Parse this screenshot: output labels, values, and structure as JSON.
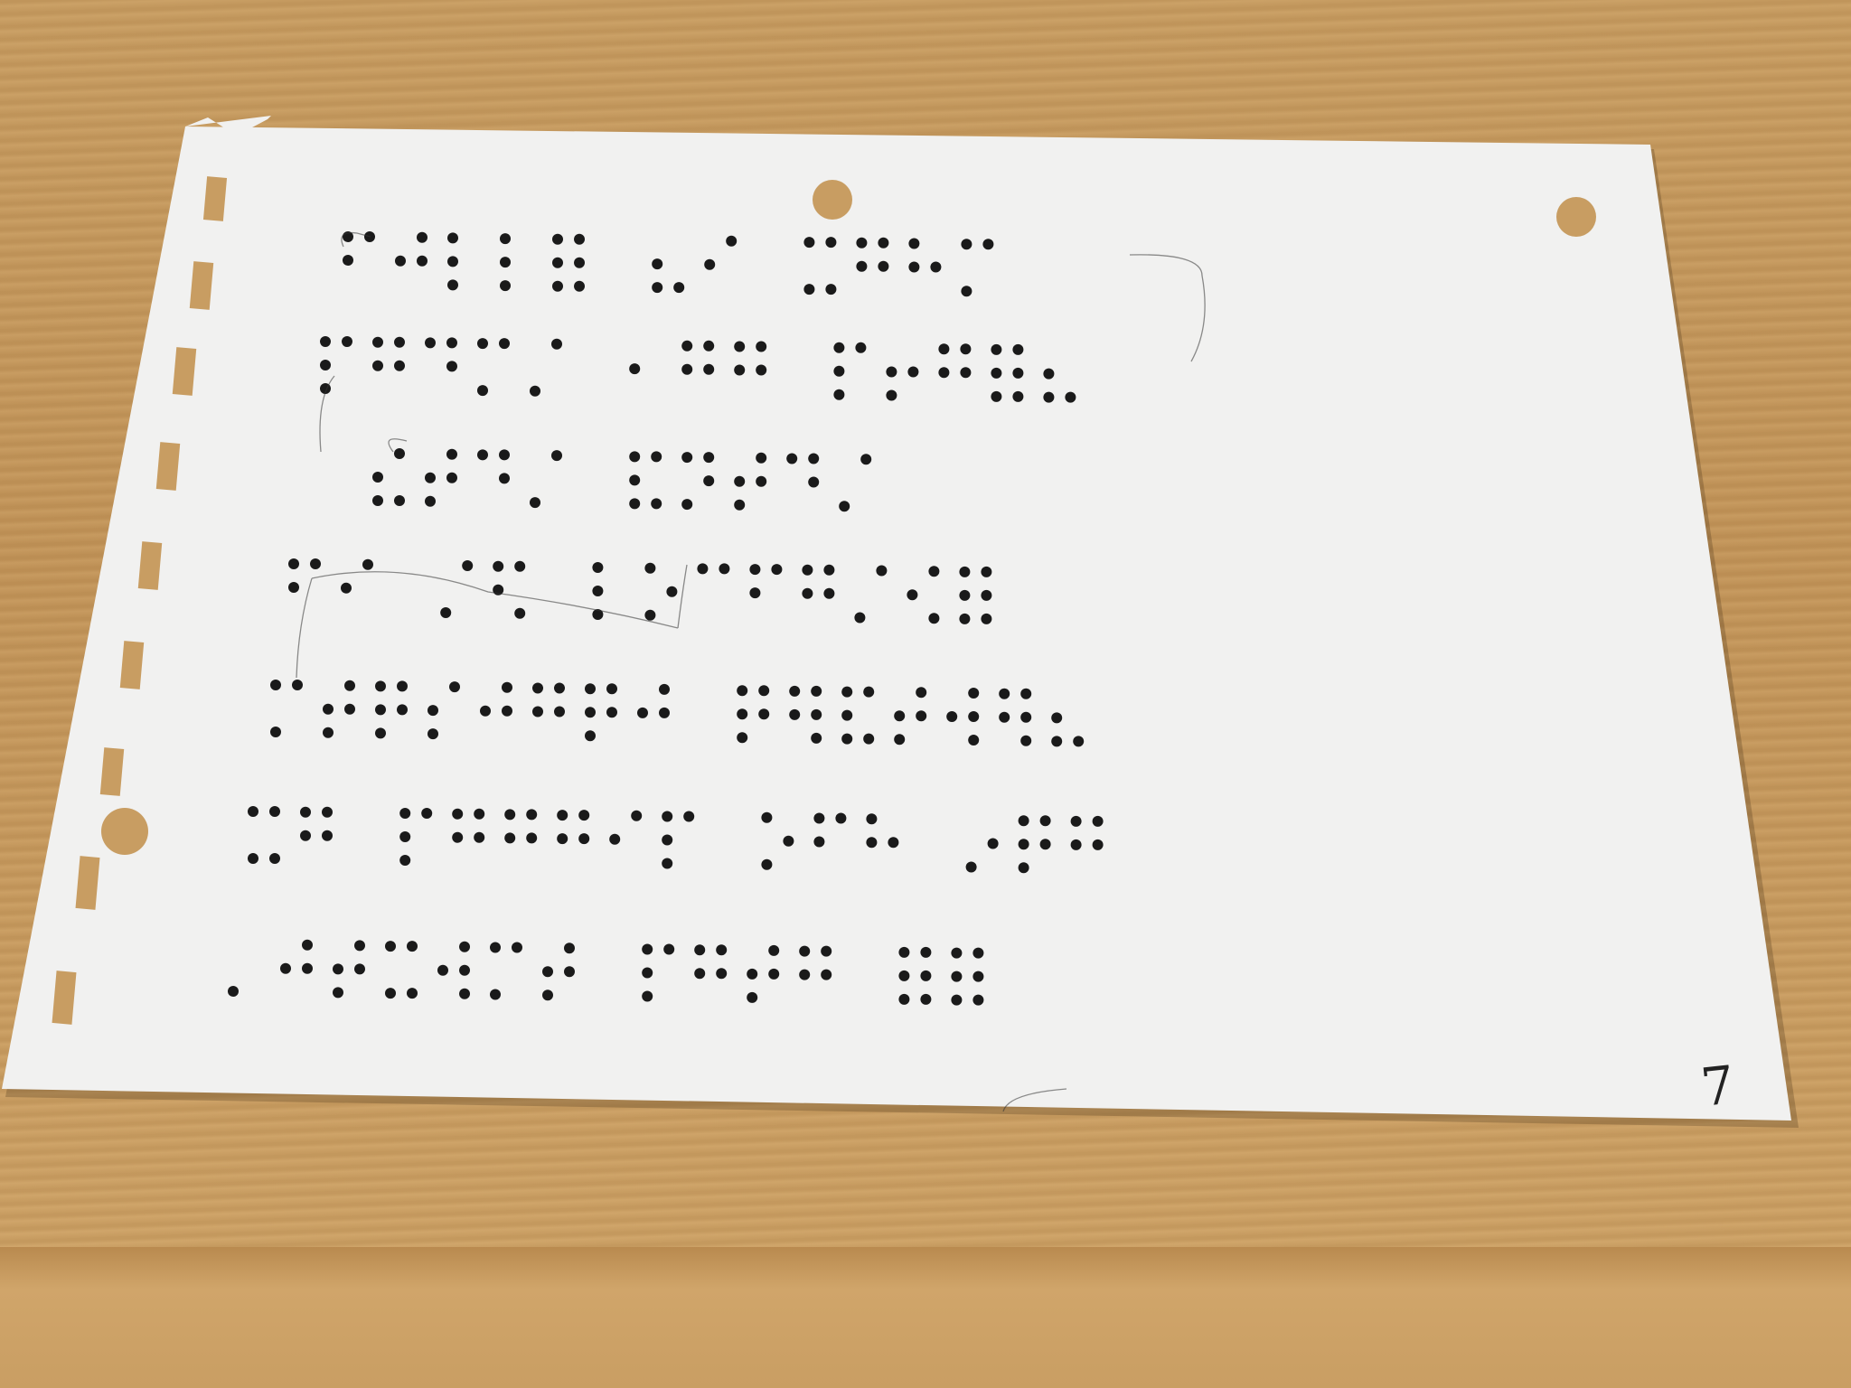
{
  "scene": {
    "description_label": "",
    "paper_color": "#f1f1f0",
    "desk_color": "#c79a5c",
    "dot_color": "#1a1a1a"
  },
  "page_number": "7"
}
